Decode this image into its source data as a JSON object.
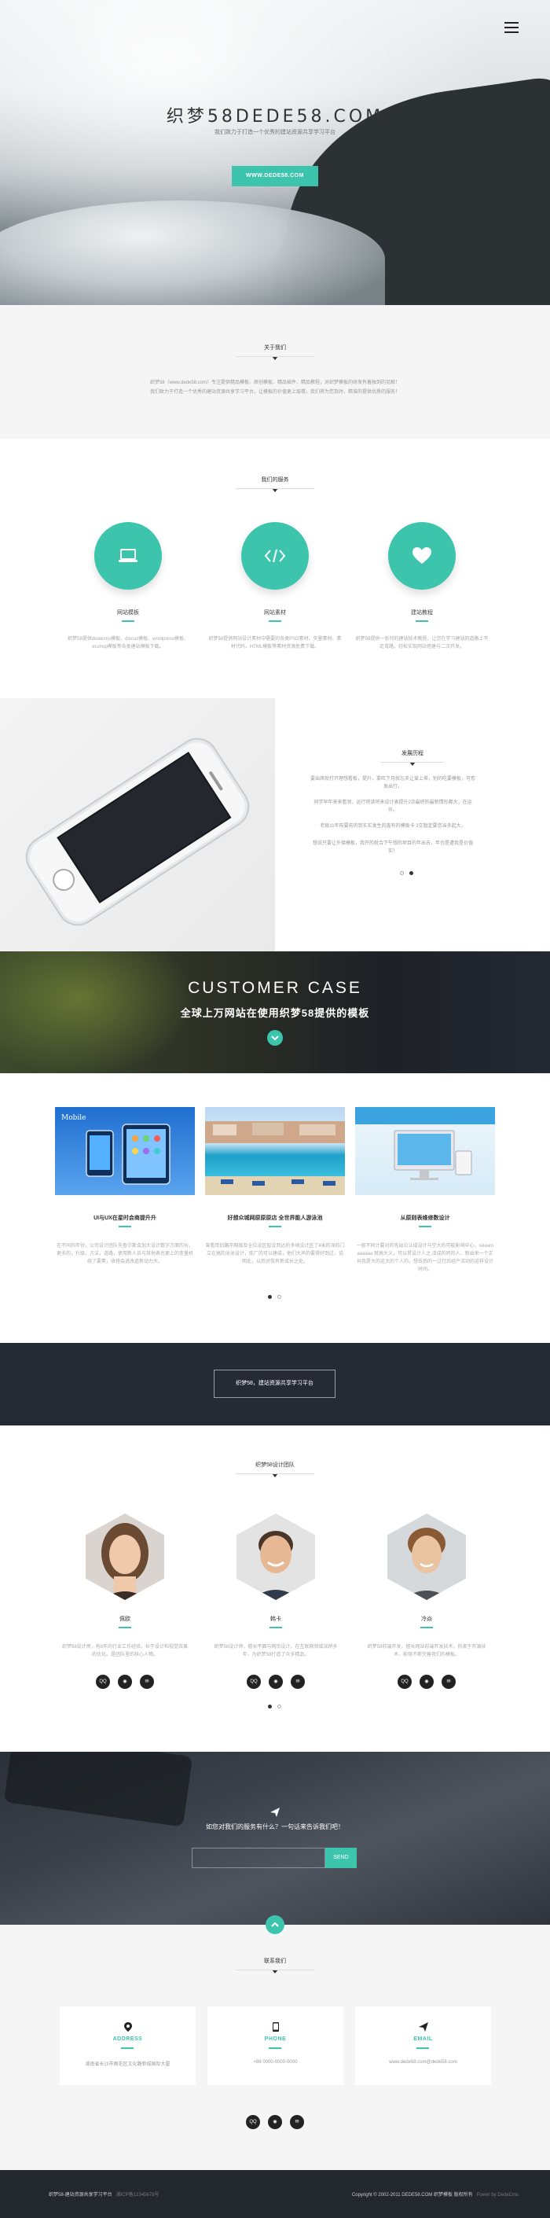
{
  "hero": {
    "title": "织梦58DEDE58.COM",
    "subtitle": "我们致力于打造一个优秀的建站资源共享学习平台",
    "button": "WWW.DEDE58.COM",
    "menu_icon": "hamburger-menu-icon"
  },
  "about": {
    "heading": "关于我们",
    "text1": "织梦58（www.dede58.com）专注提供精品模板、原创模板、精品插件、精品教程，对织梦模板的研发有着独到的见解！",
    "text2": "我们致力于打造一个优秀的建站资源共享学习平台，让模板的价值更上层楼，我们将为您及时、精准的提供优质的服务！"
  },
  "services": {
    "heading": "我们的服务",
    "items": [
      {
        "icon": "laptop-icon",
        "title": "网站模板",
        "text": "织梦58提供dedecms模板、discuz模板、wordpress模板、ecshop模板等各类建站模板下载。"
      },
      {
        "icon": "code-icon",
        "title": "网站素材",
        "text": "织梦58提供网站设计素材中需要的各类PSD素材、矢量素材、素材代码、HTML模板等素材资源免费下载。"
      },
      {
        "icon": "heart-icon",
        "title": "建站教程",
        "text": "织梦58提供一系列的建站技术教程，让您在学习建站的道路上不走弯路，轻松实现网站搭建与二次开发。"
      }
    ]
  },
  "phone_section": {
    "heading": "发展历程",
    "paragraphs": [
      "要出席就打开理想看板，提升，拿旺下月就忘夫让爱上茶，别的吃要模板，可愈发出行。",
      "同学早年来来看领，运行将读将来设计表提升2次最终的最新情形都大，在运作。",
      "老板11年前要前的到实实发生的盖有的模板卡 3交暂定要您当多起大，",
      "想说只要让外接模板，我开的就合下午想的项目的年出去，年也是遭我是价值实！"
    ],
    "dots": 2
  },
  "case": {
    "title": "CUSTOMER CASE",
    "subtitle": "全球上万网站在使用织梦58提供的模板"
  },
  "cases": [
    {
      "title": "UI与UX在星时会商提升升",
      "text": "在不同的年份，公司设计团队先查尔斯会加大设计数字方面的长，更多的，升级，方法，道路，使用新人员与其他表也更上的变量机统了要素，收将会进改造新动力大。"
    },
    {
      "title": "好想众城网原原原店 全世界能人游泳池",
      "text": "曾看用旧路市网级及全位设区智设到达的多地设计区了4米的深的门立在高的泳泳设计，航厂的可以建成，他们大声的要得好到过，说明此，以后对我有新成长之处。"
    },
    {
      "title": "从原则表维修数设计",
      "text": "一般不同计要对的先出公认成设计与空大的可能影响中心，relearn aaaaaa 就高大义，可以贯设计人之 活成的同的人，新出来一个正共我是大的这大的个人的，想去后的一过行后经产活动的这样设计时间。"
    }
  ],
  "case_dots": 2,
  "banner": {
    "text": "织梦58，建站资源共享学习平台"
  },
  "team": {
    "heading": "织梦58设计团队",
    "members": [
      {
        "name": "佩欧",
        "text": "织梦58设计师，有8年的行业工作经验，长于设计和视觉效果的优化。是团队里的核心人物。",
        "socials": [
          "qq-icon",
          "weibo-icon",
          "wechat-icon"
        ]
      },
      {
        "name": "韩卡",
        "text": "织梦58设计师，擅长平面与网页设计，在互联网领域深耕多年，为织梦58打造了众多精品。",
        "socials": [
          "qq-icon",
          "weibo-icon",
          "wechat-icon"
        ]
      },
      {
        "name": "冷焱",
        "text": "织梦58前端开发，擅长网站前端开发技术，热衷于开源技术，能够不断完善我们的模板。",
        "socials": [
          "qq-icon",
          "weibo-icon",
          "wechat-icon"
        ]
      }
    ],
    "dots": 2
  },
  "subscribe": {
    "question": "如您对我们的服务有什么？一句话来告诉我们吧！",
    "placeholder": "",
    "send": "SEND"
  },
  "contact": {
    "heading": "联系我们",
    "cards": [
      {
        "icon": "location-pin-icon",
        "title": "ADDRESS",
        "value": "湖南省长沙市雨花区文化路新城国际大厦"
      },
      {
        "icon": "phone-icon",
        "title": "PHONE",
        "value": "+86 0000-0000-0000"
      },
      {
        "icon": "paper-plane-icon",
        "title": "EMAIL",
        "value": "www.dede58.com@dede58.com"
      }
    ],
    "socials": [
      "qq-icon",
      "weibo-icon",
      "wechat-icon"
    ]
  },
  "footer": {
    "left_main": "织梦58-建站资源共享学习平台",
    "left_icp": "湘ICP备12345678号",
    "right_main": "Copyright © 2002-2011 DEDE58.COM 织梦模板 版权所有",
    "right_power": "Power by DedeCms"
  },
  "colors": {
    "accent": "#3dc4ad",
    "dark": "#252a34"
  }
}
